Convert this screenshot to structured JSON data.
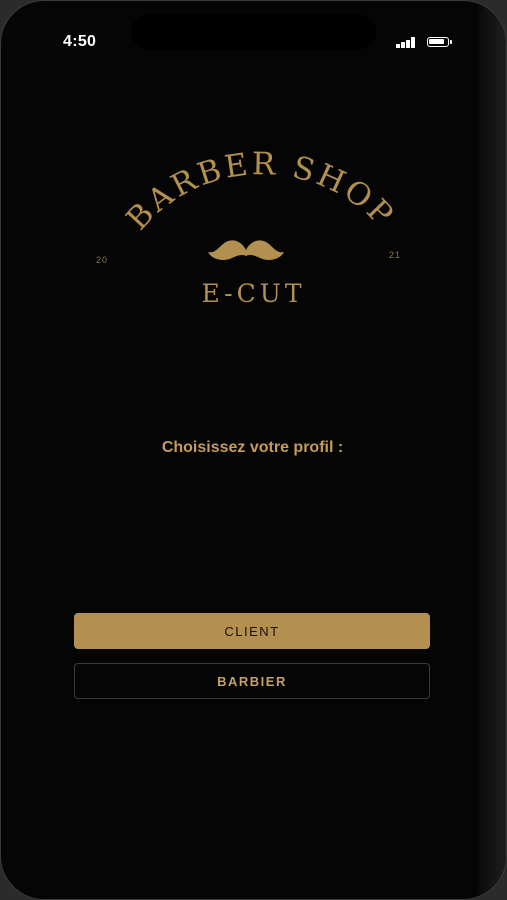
{
  "status_bar": {
    "time": "4:50",
    "signal_icon": "cellular-signal-icon",
    "battery_icon": "battery-icon"
  },
  "logo": {
    "arc_text": "BARBER SHOP",
    "year_left": "20",
    "year_right": "21",
    "brand": "E-CUT",
    "emblem_icon": "mustache-icon"
  },
  "prompt": "Choisissez votre profil :",
  "buttons": {
    "client": "CLIENT",
    "barbier": "BARBIER"
  },
  "colors": {
    "gold": "#b3904f",
    "background": "#050505"
  }
}
